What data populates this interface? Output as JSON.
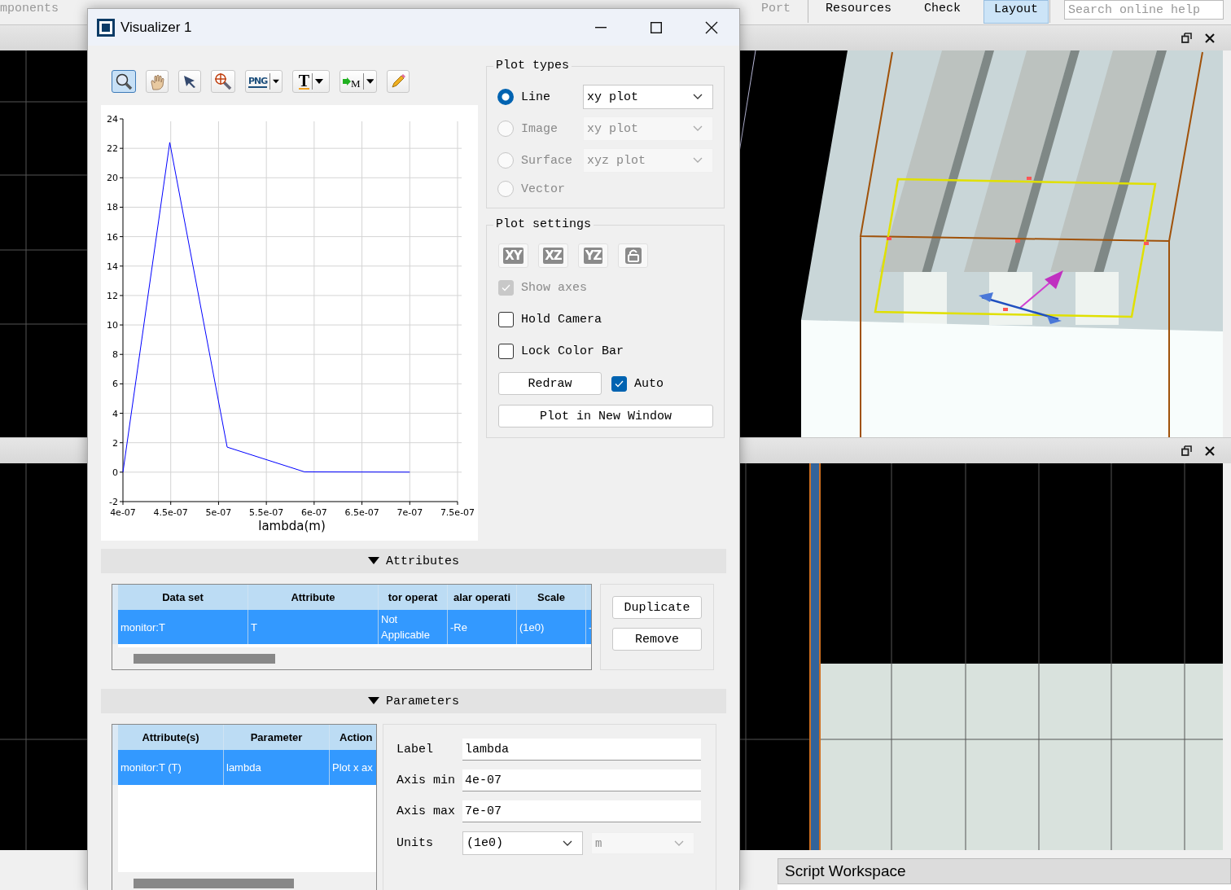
{
  "ribbon": {
    "groups": [
      {
        "tabs": [
          {
            "label": "mponents",
            "disabled": true,
            "selected": false
          },
          {
            "label": "Port",
            "disabled": true,
            "selected": false
          }
        ]
      },
      {
        "tabs": [
          {
            "label": "Resources",
            "disabled": false,
            "selected": false
          },
          {
            "label": "Check",
            "disabled": false,
            "selected": false
          },
          {
            "label": "Layout",
            "disabled": false,
            "selected": true
          }
        ]
      }
    ],
    "search": {
      "placeholder": "Search online help"
    }
  },
  "view_rows": [
    {
      "panes": [
        {
          "kind": "grid"
        },
        {
          "kind": "perspective"
        }
      ]
    },
    {
      "panes": [
        {
          "kind": "mesh"
        }
      ]
    }
  ],
  "script_workspace": {
    "title": "Script Workspace"
  },
  "dialog": {
    "title": "Visualizer 1",
    "toolbar": [
      {
        "kind": "zoom",
        "selected": true
      },
      {
        "kind": "pan",
        "selected": false
      },
      {
        "kind": "select",
        "selected": false
      },
      {
        "kind": "zoomfit",
        "selected": false
      },
      {
        "kind": "export",
        "selected": false,
        "glyph": "PNG",
        "dropdown": true
      },
      {
        "kind": "text",
        "selected": false,
        "glyph": "T",
        "dropdown": true
      },
      {
        "kind": "marker",
        "selected": false,
        "glyph": "M",
        "dropdown": true
      },
      {
        "kind": "edit",
        "selected": false
      }
    ],
    "plot": {
      "chart_data": {
        "type": "line",
        "grid": true,
        "xlabel": "lambda(m)",
        "x": [
          4e-07,
          4.49e-07,
          5.09e-07,
          5.9e-07,
          7e-07
        ],
        "series": [
          {
            "color": "#0000ff",
            "values": [
              0,
              22.4,
              1.7,
              0.02,
              0
            ]
          }
        ],
        "xlim": [
          4e-07,
          7.5e-07
        ],
        "ylim": [
          -2,
          24
        ],
        "xticks": [
          {
            "value": 4e-07,
            "label": "4e-07"
          },
          {
            "value": 4.5e-07,
            "label": "4.5e-07"
          },
          {
            "value": 5e-07,
            "label": "5e-07"
          },
          {
            "value": 5.5e-07,
            "label": "5.5e-07"
          },
          {
            "value": 6e-07,
            "label": "6e-07"
          },
          {
            "value": 6.5e-07,
            "label": "6.5e-07"
          },
          {
            "value": 7e-07,
            "label": "7e-07"
          },
          {
            "value": 7.5e-07,
            "label": "7.5e-07"
          }
        ],
        "yticks": [
          -2,
          0,
          2,
          4,
          6,
          8,
          10,
          12,
          14,
          16,
          18,
          20,
          22,
          24
        ]
      }
    },
    "plot_types": {
      "title": "Plot types",
      "options": [
        {
          "label": "Line",
          "selected": true,
          "disabled": false,
          "dropdown": {
            "value": "xy plot",
            "disabled": false
          }
        },
        {
          "label": "Image",
          "selected": false,
          "disabled": true,
          "dropdown": {
            "value": "xy plot",
            "disabled": true
          }
        },
        {
          "label": "Surface",
          "selected": false,
          "disabled": true,
          "dropdown": {
            "value": "xyz plot",
            "disabled": true
          }
        },
        {
          "label": "Vector",
          "selected": false,
          "disabled": true
        }
      ]
    },
    "plot_settings": {
      "title": "Plot settings",
      "views": [
        {
          "kind": "view",
          "label": "XY"
        },
        {
          "kind": "view",
          "label": "XZ"
        },
        {
          "kind": "view",
          "label": "YZ"
        },
        {
          "kind": "lock"
        }
      ],
      "checkboxes": [
        {
          "label": "Show axes",
          "checked": true,
          "disabled": true
        },
        {
          "label": "Hold Camera",
          "checked": false,
          "disabled": false
        },
        {
          "label": "Lock Color Bar",
          "checked": false,
          "disabled": false
        }
      ],
      "redraw": {
        "label": "Redraw"
      },
      "auto": {
        "label": "Auto",
        "checked": true
      },
      "new_window": {
        "label": "Plot in New Window"
      }
    },
    "attributes": {
      "title": "Attributes",
      "expanded": true,
      "columns": [
        "Data set",
        "Attribute",
        "tor operat",
        "alar operati",
        "Scale"
      ],
      "rows": [
        {
          "selected": true,
          "cells": [
            "monitor:T",
            "T",
            "Not Applicable",
            "-Re",
            "(1e0)",
            "-"
          ]
        }
      ],
      "buttons": [
        {
          "label": "Duplicate"
        },
        {
          "label": "Remove"
        }
      ]
    },
    "parameters": {
      "title": "Parameters",
      "expanded": true,
      "columns": [
        "Attribute(s)",
        "Parameter",
        "Action"
      ],
      "rows": [
        {
          "selected": true,
          "cells": [
            "monitor:T (T)",
            "lambda",
            "Plot x ax"
          ]
        }
      ],
      "fields": [
        {
          "label": "Label",
          "value": "lambda"
        },
        {
          "label": "Axis min",
          "value": "4e-07"
        },
        {
          "label": "Axis max",
          "value": "7e-07"
        }
      ],
      "units": {
        "label": "Units",
        "value": "(1e0)",
        "unit": {
          "value": "m",
          "disabled": true
        }
      }
    }
  }
}
